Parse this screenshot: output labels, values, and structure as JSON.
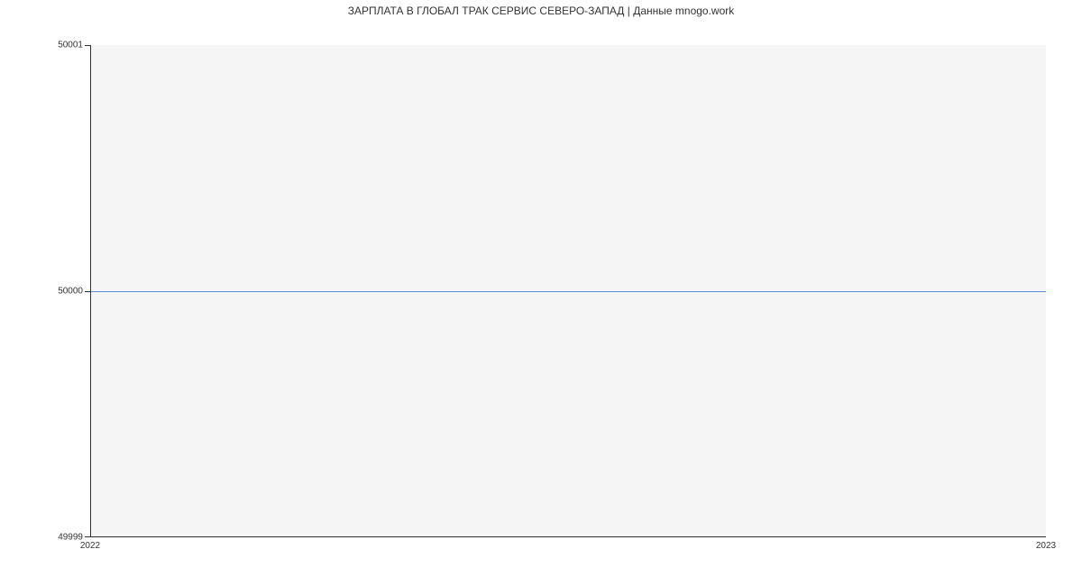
{
  "chart_data": {
    "type": "line",
    "title": "ЗАРПЛАТА В ГЛОБАЛ ТРАК СЕРВИС СЕВЕРО-ЗАПАД | Данные mnogo.work",
    "xlabel": "",
    "ylabel": "",
    "x": [
      "2022",
      "2023"
    ],
    "y": [
      50000,
      50000
    ],
    "xlim": [
      "2022",
      "2023"
    ],
    "ylim": [
      49999,
      50001
    ],
    "y_ticks": [
      "49999",
      "50000",
      "50001"
    ],
    "x_ticks": [
      "2022",
      "2023"
    ],
    "grid": false,
    "line_color": "#5b8fd6",
    "background": "#f5f5f5"
  }
}
